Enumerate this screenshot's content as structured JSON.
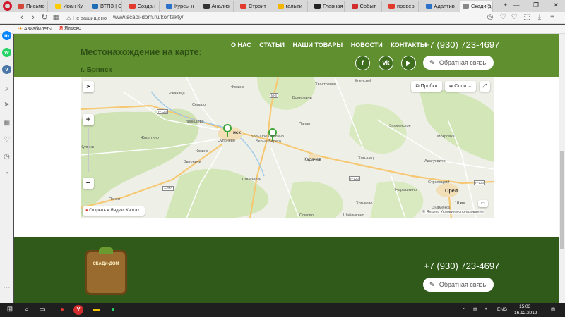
{
  "browser": {
    "tabs": [
      {
        "label": "Письмо",
        "color": "#d44638"
      },
      {
        "label": "Иван Ку",
        "color": "#ffcc00"
      },
      {
        "label": "ВТПЗ | О",
        "color": "#1e6bb8"
      },
      {
        "label": "Создан",
        "color": "#e23b2e"
      },
      {
        "label": "Курсы н",
        "color": "#2a72c9"
      },
      {
        "label": "Анализ",
        "color": "#333333"
      },
      {
        "label": "Строит",
        "color": "#e23b2e"
      },
      {
        "label": "галыги",
        "color": "#f2b600"
      },
      {
        "label": "Главная",
        "color": "#222222"
      },
      {
        "label": "Событ",
        "color": "#d22c2c"
      },
      {
        "label": "провер",
        "color": "#e23b2e"
      },
      {
        "label": "Адаптив",
        "color": "#2a72c9"
      },
      {
        "label": "Скади-д",
        "color": "#888888",
        "active": true
      }
    ],
    "security_label": "Не защищено",
    "url": "www.scadi-dom.ru/kontakty/",
    "bookmarks": [
      {
        "label": "Авиабилеты"
      },
      {
        "label": "Яндекс"
      }
    ]
  },
  "header": {
    "map_title": "Местонахождение на карте:",
    "nav": [
      "О НАС",
      "СТАТЬИ",
      "НАШИ ТОВАРЫ",
      "НОВОСТИ",
      "КОНТАКТЫ"
    ],
    "phone": "+7 (930) 723-4697",
    "city": "г. Брянск",
    "social": [
      "f",
      "vk",
      "yt"
    ],
    "callback_label": "Обратная связь"
  },
  "map": {
    "traffic_label": "Пробки",
    "layers_label": "Слои",
    "open_label": "Открыть в Яндекс Картах",
    "scale_label": "10 км",
    "copyright": "© Яндекс Условия использования",
    "towns": [
      "Фокино",
      "Хвастовичи",
      "Еленский",
      "Ржаница",
      "Сельцо",
      "Бояновичи",
      "Глинищево",
      "нск",
      "Супонево",
      "Большое Полпино",
      "Белые Берега",
      "Палцо",
      "Знаменское",
      "Жирятино",
      "Кокино",
      "Выгоничи",
      "Мокровка",
      "Карачев",
      "Хотынец",
      "Адагуевичи",
      "Синезерки",
      "Нарышкино",
      "Стрелецкий",
      "Почеп",
      "Орёл",
      "Хотьково",
      "Знаменка",
      "Сомово",
      "Шаблыкино",
      "Кулмчи"
    ],
    "road_labels": [
      "Р-120",
      "М-3",
      "А-240",
      "Р-120",
      "Р-120"
    ]
  },
  "footer": {
    "brand": "СКАДИ-ДОМ",
    "phone": "+7 (930) 723-4697",
    "callback_label": "Обратная связь"
  },
  "taskbar": {
    "lang": "ENG",
    "time": "15:03",
    "date": "16.12.2019"
  }
}
